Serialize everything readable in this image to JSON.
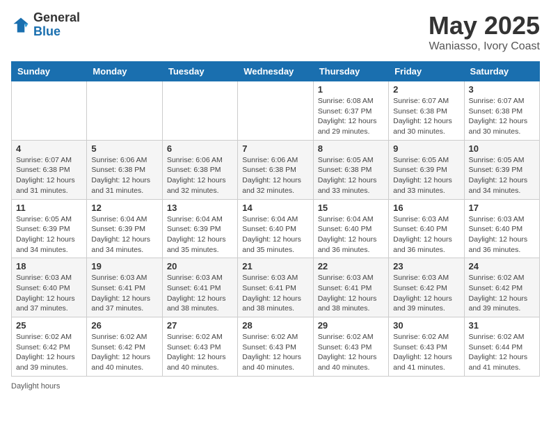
{
  "header": {
    "logo_line1": "General",
    "logo_line2": "Blue",
    "month": "May 2025",
    "location": "Waniasso, Ivory Coast"
  },
  "days_of_week": [
    "Sunday",
    "Monday",
    "Tuesday",
    "Wednesday",
    "Thursday",
    "Friday",
    "Saturday"
  ],
  "weeks": [
    [
      {
        "day": "",
        "content": ""
      },
      {
        "day": "",
        "content": ""
      },
      {
        "day": "",
        "content": ""
      },
      {
        "day": "",
        "content": ""
      },
      {
        "day": "1",
        "content": "Sunrise: 6:08 AM\nSunset: 6:37 PM\nDaylight: 12 hours and 29 minutes."
      },
      {
        "day": "2",
        "content": "Sunrise: 6:07 AM\nSunset: 6:38 PM\nDaylight: 12 hours and 30 minutes."
      },
      {
        "day": "3",
        "content": "Sunrise: 6:07 AM\nSunset: 6:38 PM\nDaylight: 12 hours and 30 minutes."
      }
    ],
    [
      {
        "day": "4",
        "content": "Sunrise: 6:07 AM\nSunset: 6:38 PM\nDaylight: 12 hours and 31 minutes."
      },
      {
        "day": "5",
        "content": "Sunrise: 6:06 AM\nSunset: 6:38 PM\nDaylight: 12 hours and 31 minutes."
      },
      {
        "day": "6",
        "content": "Sunrise: 6:06 AM\nSunset: 6:38 PM\nDaylight: 12 hours and 32 minutes."
      },
      {
        "day": "7",
        "content": "Sunrise: 6:06 AM\nSunset: 6:38 PM\nDaylight: 12 hours and 32 minutes."
      },
      {
        "day": "8",
        "content": "Sunrise: 6:05 AM\nSunset: 6:38 PM\nDaylight: 12 hours and 33 minutes."
      },
      {
        "day": "9",
        "content": "Sunrise: 6:05 AM\nSunset: 6:39 PM\nDaylight: 12 hours and 33 minutes."
      },
      {
        "day": "10",
        "content": "Sunrise: 6:05 AM\nSunset: 6:39 PM\nDaylight: 12 hours and 34 minutes."
      }
    ],
    [
      {
        "day": "11",
        "content": "Sunrise: 6:05 AM\nSunset: 6:39 PM\nDaylight: 12 hours and 34 minutes."
      },
      {
        "day": "12",
        "content": "Sunrise: 6:04 AM\nSunset: 6:39 PM\nDaylight: 12 hours and 34 minutes."
      },
      {
        "day": "13",
        "content": "Sunrise: 6:04 AM\nSunset: 6:39 PM\nDaylight: 12 hours and 35 minutes."
      },
      {
        "day": "14",
        "content": "Sunrise: 6:04 AM\nSunset: 6:40 PM\nDaylight: 12 hours and 35 minutes."
      },
      {
        "day": "15",
        "content": "Sunrise: 6:04 AM\nSunset: 6:40 PM\nDaylight: 12 hours and 36 minutes."
      },
      {
        "day": "16",
        "content": "Sunrise: 6:03 AM\nSunset: 6:40 PM\nDaylight: 12 hours and 36 minutes."
      },
      {
        "day": "17",
        "content": "Sunrise: 6:03 AM\nSunset: 6:40 PM\nDaylight: 12 hours and 36 minutes."
      }
    ],
    [
      {
        "day": "18",
        "content": "Sunrise: 6:03 AM\nSunset: 6:40 PM\nDaylight: 12 hours and 37 minutes."
      },
      {
        "day": "19",
        "content": "Sunrise: 6:03 AM\nSunset: 6:41 PM\nDaylight: 12 hours and 37 minutes."
      },
      {
        "day": "20",
        "content": "Sunrise: 6:03 AM\nSunset: 6:41 PM\nDaylight: 12 hours and 38 minutes."
      },
      {
        "day": "21",
        "content": "Sunrise: 6:03 AM\nSunset: 6:41 PM\nDaylight: 12 hours and 38 minutes."
      },
      {
        "day": "22",
        "content": "Sunrise: 6:03 AM\nSunset: 6:41 PM\nDaylight: 12 hours and 38 minutes."
      },
      {
        "day": "23",
        "content": "Sunrise: 6:03 AM\nSunset: 6:42 PM\nDaylight: 12 hours and 39 minutes."
      },
      {
        "day": "24",
        "content": "Sunrise: 6:02 AM\nSunset: 6:42 PM\nDaylight: 12 hours and 39 minutes."
      }
    ],
    [
      {
        "day": "25",
        "content": "Sunrise: 6:02 AM\nSunset: 6:42 PM\nDaylight: 12 hours and 39 minutes."
      },
      {
        "day": "26",
        "content": "Sunrise: 6:02 AM\nSunset: 6:42 PM\nDaylight: 12 hours and 40 minutes."
      },
      {
        "day": "27",
        "content": "Sunrise: 6:02 AM\nSunset: 6:43 PM\nDaylight: 12 hours and 40 minutes."
      },
      {
        "day": "28",
        "content": "Sunrise: 6:02 AM\nSunset: 6:43 PM\nDaylight: 12 hours and 40 minutes."
      },
      {
        "day": "29",
        "content": "Sunrise: 6:02 AM\nSunset: 6:43 PM\nDaylight: 12 hours and 40 minutes."
      },
      {
        "day": "30",
        "content": "Sunrise: 6:02 AM\nSunset: 6:43 PM\nDaylight: 12 hours and 41 minutes."
      },
      {
        "day": "31",
        "content": "Sunrise: 6:02 AM\nSunset: 6:44 PM\nDaylight: 12 hours and 41 minutes."
      }
    ]
  ],
  "legend": {
    "text": "Daylight hours"
  }
}
